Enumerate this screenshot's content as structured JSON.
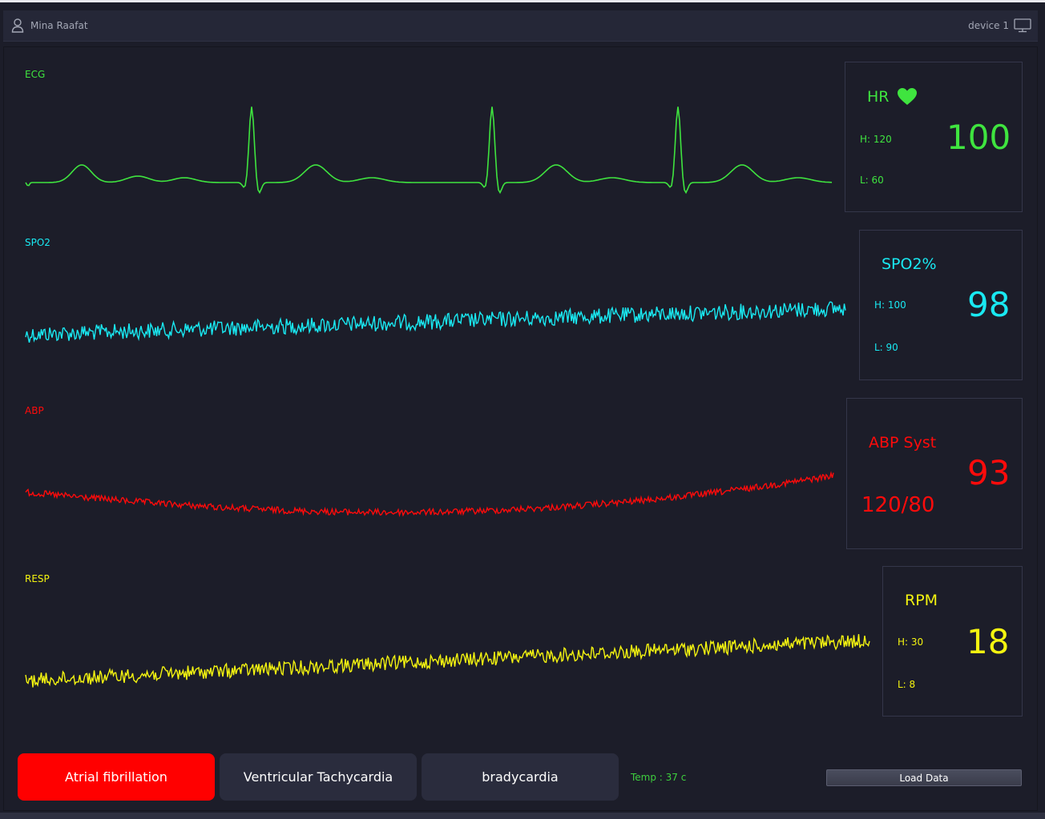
{
  "header": {
    "user_name": "Mina Raafat",
    "device_name": "device 1",
    "icons": [
      "user-icon",
      "monitor-icon"
    ]
  },
  "channels": {
    "ecg": {
      "label": "ECG",
      "color": "#3fe43f"
    },
    "spo2": {
      "label": "SPO2",
      "color": "#19e9f2"
    },
    "abp": {
      "label": "ABP",
      "color": "#ff0b0b"
    },
    "resp": {
      "label": "RESP",
      "color": "#f4f410"
    }
  },
  "vitals": {
    "hr": {
      "title": "HR",
      "value": "100",
      "high": "H: 120",
      "low": "L: 60",
      "icon": "heart-icon"
    },
    "spo2": {
      "title": "SPO2%",
      "value": "98",
      "high": "H: 100",
      "low": "L: 90"
    },
    "abp": {
      "title": "ABP Syst",
      "value": "93",
      "pressure": "120/80"
    },
    "rpm": {
      "title": "RPM",
      "value": "18",
      "high": "H: 30",
      "low": "L: 8"
    }
  },
  "buttons": {
    "af": "Atrial fibrillation",
    "vt": "Ventricular Tachycardia",
    "brady": "bradycardia",
    "load": "Load Data"
  },
  "temperature": "Temp : 37 c",
  "selected_arrhythmia": "Atrial fibrillation"
}
